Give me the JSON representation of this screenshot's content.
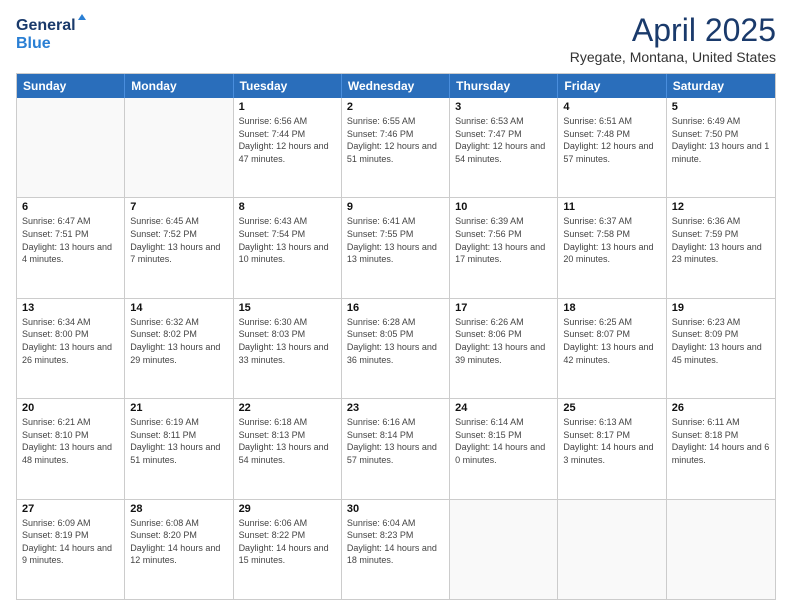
{
  "header": {
    "logo_line1": "General",
    "logo_line2": "Blue",
    "month": "April 2025",
    "location": "Ryegate, Montana, United States"
  },
  "weekdays": [
    "Sunday",
    "Monday",
    "Tuesday",
    "Wednesday",
    "Thursday",
    "Friday",
    "Saturday"
  ],
  "rows": [
    [
      {
        "day": "",
        "text": ""
      },
      {
        "day": "",
        "text": ""
      },
      {
        "day": "1",
        "text": "Sunrise: 6:56 AM\nSunset: 7:44 PM\nDaylight: 12 hours and 47 minutes."
      },
      {
        "day": "2",
        "text": "Sunrise: 6:55 AM\nSunset: 7:46 PM\nDaylight: 12 hours and 51 minutes."
      },
      {
        "day": "3",
        "text": "Sunrise: 6:53 AM\nSunset: 7:47 PM\nDaylight: 12 hours and 54 minutes."
      },
      {
        "day": "4",
        "text": "Sunrise: 6:51 AM\nSunset: 7:48 PM\nDaylight: 12 hours and 57 minutes."
      },
      {
        "day": "5",
        "text": "Sunrise: 6:49 AM\nSunset: 7:50 PM\nDaylight: 13 hours and 1 minute."
      }
    ],
    [
      {
        "day": "6",
        "text": "Sunrise: 6:47 AM\nSunset: 7:51 PM\nDaylight: 13 hours and 4 minutes."
      },
      {
        "day": "7",
        "text": "Sunrise: 6:45 AM\nSunset: 7:52 PM\nDaylight: 13 hours and 7 minutes."
      },
      {
        "day": "8",
        "text": "Sunrise: 6:43 AM\nSunset: 7:54 PM\nDaylight: 13 hours and 10 minutes."
      },
      {
        "day": "9",
        "text": "Sunrise: 6:41 AM\nSunset: 7:55 PM\nDaylight: 13 hours and 13 minutes."
      },
      {
        "day": "10",
        "text": "Sunrise: 6:39 AM\nSunset: 7:56 PM\nDaylight: 13 hours and 17 minutes."
      },
      {
        "day": "11",
        "text": "Sunrise: 6:37 AM\nSunset: 7:58 PM\nDaylight: 13 hours and 20 minutes."
      },
      {
        "day": "12",
        "text": "Sunrise: 6:36 AM\nSunset: 7:59 PM\nDaylight: 13 hours and 23 minutes."
      }
    ],
    [
      {
        "day": "13",
        "text": "Sunrise: 6:34 AM\nSunset: 8:00 PM\nDaylight: 13 hours and 26 minutes."
      },
      {
        "day": "14",
        "text": "Sunrise: 6:32 AM\nSunset: 8:02 PM\nDaylight: 13 hours and 29 minutes."
      },
      {
        "day": "15",
        "text": "Sunrise: 6:30 AM\nSunset: 8:03 PM\nDaylight: 13 hours and 33 minutes."
      },
      {
        "day": "16",
        "text": "Sunrise: 6:28 AM\nSunset: 8:05 PM\nDaylight: 13 hours and 36 minutes."
      },
      {
        "day": "17",
        "text": "Sunrise: 6:26 AM\nSunset: 8:06 PM\nDaylight: 13 hours and 39 minutes."
      },
      {
        "day": "18",
        "text": "Sunrise: 6:25 AM\nSunset: 8:07 PM\nDaylight: 13 hours and 42 minutes."
      },
      {
        "day": "19",
        "text": "Sunrise: 6:23 AM\nSunset: 8:09 PM\nDaylight: 13 hours and 45 minutes."
      }
    ],
    [
      {
        "day": "20",
        "text": "Sunrise: 6:21 AM\nSunset: 8:10 PM\nDaylight: 13 hours and 48 minutes."
      },
      {
        "day": "21",
        "text": "Sunrise: 6:19 AM\nSunset: 8:11 PM\nDaylight: 13 hours and 51 minutes."
      },
      {
        "day": "22",
        "text": "Sunrise: 6:18 AM\nSunset: 8:13 PM\nDaylight: 13 hours and 54 minutes."
      },
      {
        "day": "23",
        "text": "Sunrise: 6:16 AM\nSunset: 8:14 PM\nDaylight: 13 hours and 57 minutes."
      },
      {
        "day": "24",
        "text": "Sunrise: 6:14 AM\nSunset: 8:15 PM\nDaylight: 14 hours and 0 minutes."
      },
      {
        "day": "25",
        "text": "Sunrise: 6:13 AM\nSunset: 8:17 PM\nDaylight: 14 hours and 3 minutes."
      },
      {
        "day": "26",
        "text": "Sunrise: 6:11 AM\nSunset: 8:18 PM\nDaylight: 14 hours and 6 minutes."
      }
    ],
    [
      {
        "day": "27",
        "text": "Sunrise: 6:09 AM\nSunset: 8:19 PM\nDaylight: 14 hours and 9 minutes."
      },
      {
        "day": "28",
        "text": "Sunrise: 6:08 AM\nSunset: 8:20 PM\nDaylight: 14 hours and 12 minutes."
      },
      {
        "day": "29",
        "text": "Sunrise: 6:06 AM\nSunset: 8:22 PM\nDaylight: 14 hours and 15 minutes."
      },
      {
        "day": "30",
        "text": "Sunrise: 6:04 AM\nSunset: 8:23 PM\nDaylight: 14 hours and 18 minutes."
      },
      {
        "day": "",
        "text": ""
      },
      {
        "day": "",
        "text": ""
      },
      {
        "day": "",
        "text": ""
      }
    ]
  ]
}
